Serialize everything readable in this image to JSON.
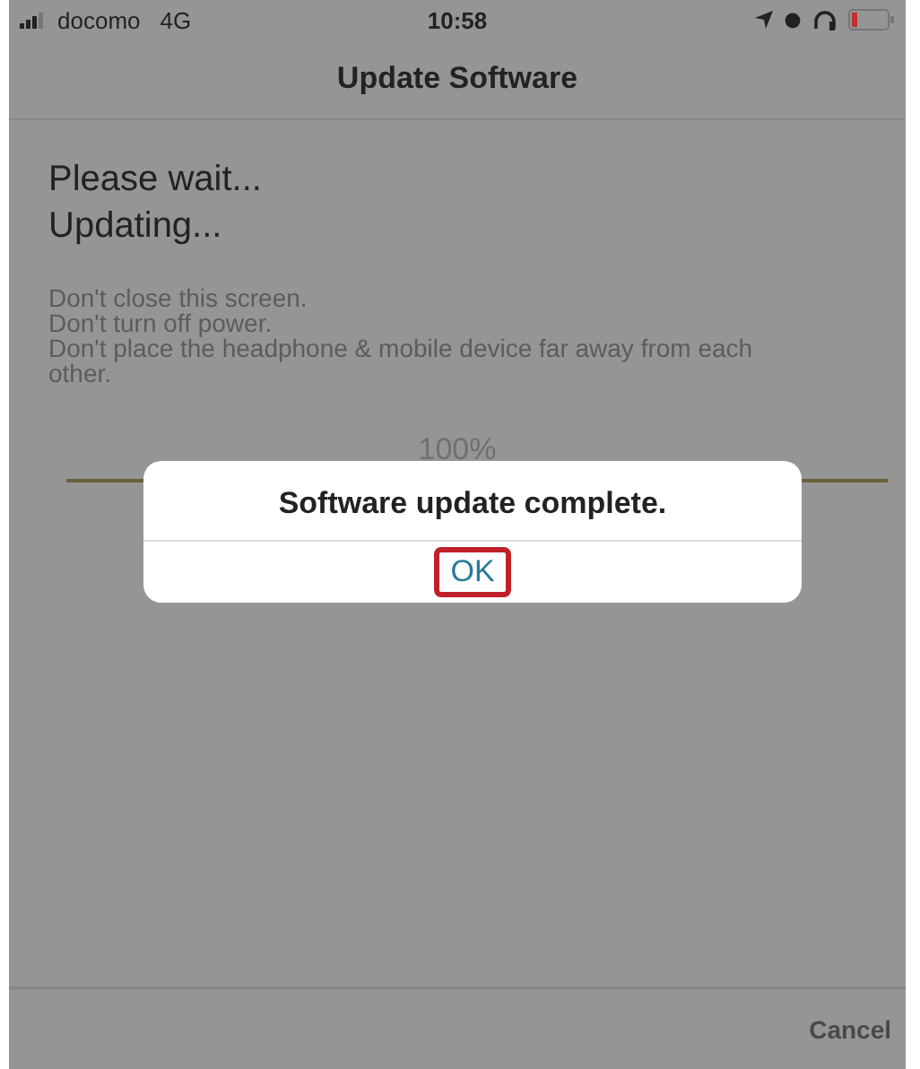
{
  "status_bar": {
    "carrier": "docomo",
    "network": "4G",
    "time": "10:58"
  },
  "nav": {
    "title": "Update Software"
  },
  "headings": [
    "Please wait...",
    "Updating..."
  ],
  "notes": [
    "Don't close this screen.",
    "Don't turn off power.",
    "Don't place the headphone & mobile device far away from each other."
  ],
  "progress": {
    "reading": "100%",
    "level": 1
  },
  "dialog": {
    "message": "Software update complete.",
    "button": {
      "label": "OK",
      "highlighted": true
    }
  },
  "toolbar": {
    "cancel": "Cancel"
  }
}
